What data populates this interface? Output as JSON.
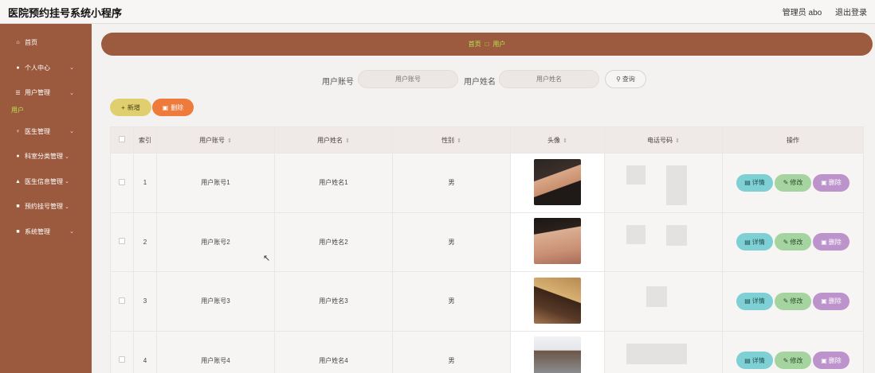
{
  "app": {
    "title": "医院预约挂号系统小程序",
    "user_label": "管理员 abo",
    "logout_label": "退出登录"
  },
  "sidebar": {
    "items": [
      {
        "icon": "home-icon",
        "glyph": "⌂",
        "label": "首页",
        "chevron": false
      },
      {
        "icon": "user-icon",
        "glyph": "●",
        "label": "个人中心",
        "chevron": true
      },
      {
        "icon": "list-icon",
        "glyph": "☰",
        "label": "用户管理",
        "chevron": true
      },
      {
        "icon": "doctor-icon",
        "glyph": "♀",
        "label": "医生管理",
        "chevron": true
      },
      {
        "icon": "user-icon",
        "glyph": "●",
        "label": "科室分类管理",
        "chevron": true
      },
      {
        "icon": "doctor-info-icon",
        "glyph": "▲",
        "label": "医生信息管理",
        "chevron": true
      },
      {
        "icon": "grid-icon",
        "glyph": "■",
        "label": "预约挂号管理",
        "chevron": true
      },
      {
        "icon": "grid-icon",
        "glyph": "■",
        "label": "系统管理",
        "chevron": true
      }
    ],
    "active_sub": "用户"
  },
  "breadcrumb": {
    "home": "首页",
    "separator": "□",
    "current": "用户"
  },
  "search": {
    "account_label": "用户账号",
    "account_placeholder": "用户账号",
    "name_label": "用户姓名",
    "name_placeholder": "用户姓名",
    "button_label": "查询"
  },
  "toolbar": {
    "add_label": "新增",
    "delete_label": "删除"
  },
  "table": {
    "headers": {
      "index": "索引",
      "account": "用户账号",
      "name": "用户姓名",
      "gender": "性别",
      "avatar": "头像",
      "phone": "电话号码",
      "ops": "操作"
    },
    "rows": [
      {
        "index": "1",
        "account": "用户账号1",
        "name": "用户姓名1",
        "gender": "男"
      },
      {
        "index": "2",
        "account": "用户账号2",
        "name": "用户姓名2",
        "gender": "男"
      },
      {
        "index": "3",
        "account": "用户账号3",
        "name": "用户姓名3",
        "gender": "男"
      },
      {
        "index": "4",
        "account": "用户账号4",
        "name": "用户姓名4",
        "gender": "男"
      }
    ],
    "actions": {
      "detail": "详情",
      "edit": "修改",
      "delete": "删除"
    }
  },
  "colors": {
    "sidebar_bg": "#9b5a3e",
    "breadcrumb_bg": "#9c5b3f",
    "active_text": "#b9e24f",
    "add_btn": "#e0cf6f",
    "del_btn": "#ee7a3c",
    "detail_btn": "#7fd0d4",
    "edit_btn": "#a6d4a0",
    "row_del_btn": "#bd93cc"
  }
}
